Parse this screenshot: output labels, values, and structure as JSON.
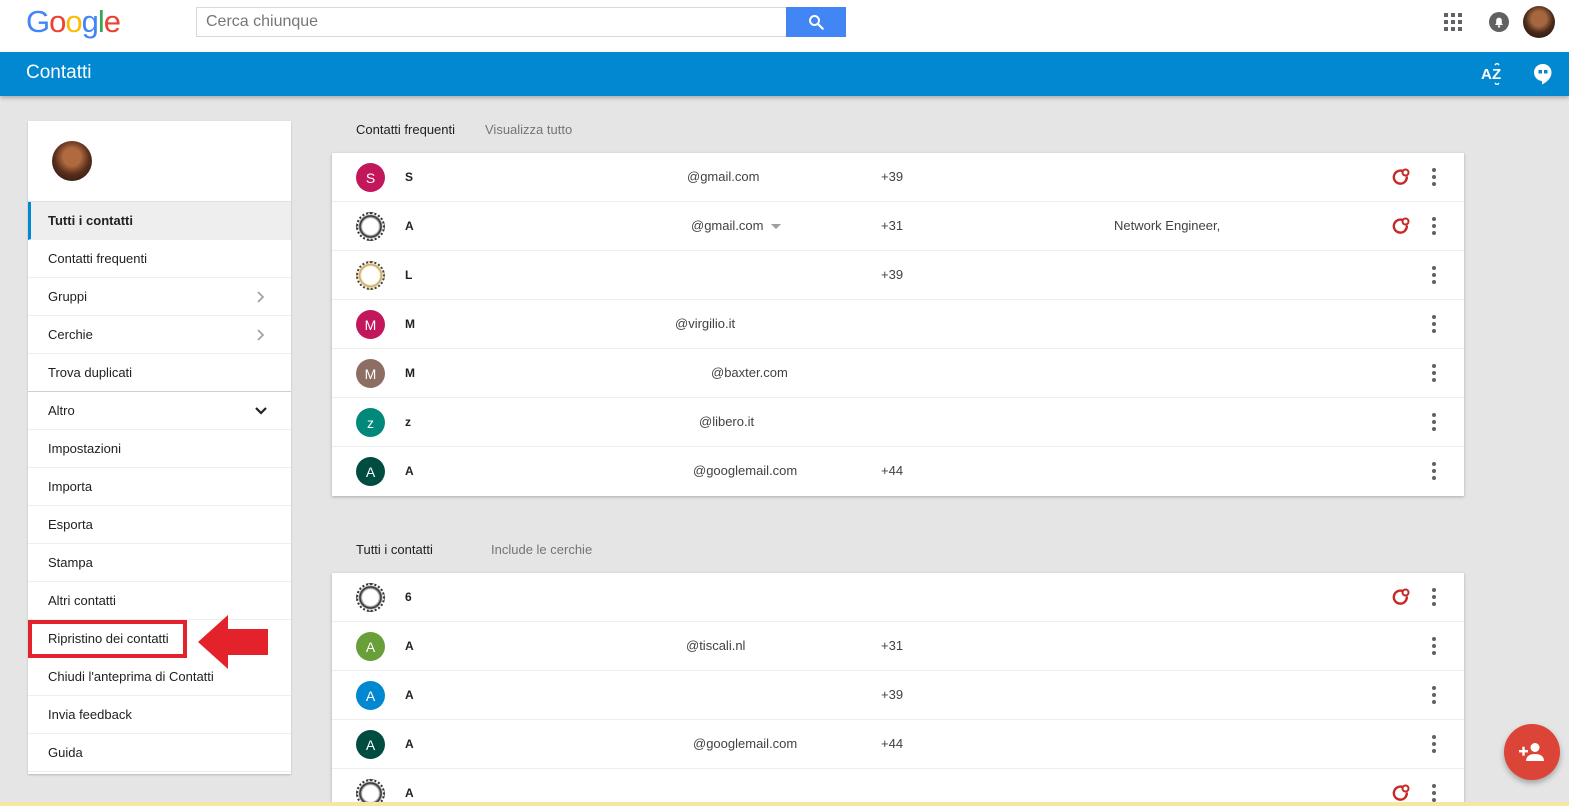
{
  "header": {
    "logo_letters": [
      {
        "ch": "G",
        "color": "#4285f4"
      },
      {
        "ch": "o",
        "color": "#ea4335"
      },
      {
        "ch": "o",
        "color": "#fbbc05"
      },
      {
        "ch": "g",
        "color": "#4285f4"
      },
      {
        "ch": "l",
        "color": "#34a853"
      },
      {
        "ch": "e",
        "color": "#ea4335"
      }
    ],
    "search_placeholder": "Cerca chiunque",
    "icons": [
      "search-icon",
      "apps-icon",
      "bell-icon",
      "avatar"
    ]
  },
  "appbar": {
    "title": "Contatti",
    "sort_label": "AZ",
    "accent": "#0288d1"
  },
  "sidebar": {
    "items": [
      {
        "label": "Tutti i contatti",
        "active": true
      },
      {
        "label": "Contatti frequenti"
      },
      {
        "label": "Gruppi",
        "chevron": "right"
      },
      {
        "label": "Cerchie",
        "chevron": "right"
      },
      {
        "label": "Trova duplicati"
      },
      {
        "label": "Altro",
        "chevron": "down"
      },
      {
        "label": "Impostazioni"
      },
      {
        "label": "Importa"
      },
      {
        "label": "Esporta"
      },
      {
        "label": "Stampa"
      },
      {
        "label": "Altri contatti"
      },
      {
        "label": "Ripristino dei contatti",
        "highlight": true
      },
      {
        "label": "Chiudi l'anteprima di Contatti"
      },
      {
        "label": "Invia feedback"
      },
      {
        "label": "Guida"
      }
    ]
  },
  "frequent": {
    "title": "Contatti frequenti",
    "link": "Visualizza tutto",
    "rows": [
      {
        "initial": "S",
        "avatar_color": "#c2185b",
        "name": "S",
        "email": "@gmail.com",
        "phone": "+39",
        "job": "",
        "circle": true
      },
      {
        "initial": "",
        "avatar_style": "photo",
        "name": "A",
        "email": "@gmail.com",
        "email_dropdown": true,
        "phone": "+31",
        "job": "Network Engineer,",
        "circle": true
      },
      {
        "initial": "",
        "avatar_style": "photo2",
        "name": "L",
        "email": "",
        "phone": "+39",
        "job": "",
        "circle": false
      },
      {
        "initial": "M",
        "avatar_color": "#c2185b",
        "name": "M",
        "email": "@virgilio.it",
        "phone": "",
        "job": "",
        "circle": false
      },
      {
        "initial": "M",
        "avatar_color": "#8d6e63",
        "name": "M",
        "email": "@baxter.com",
        "phone": "",
        "job": "",
        "circle": false
      },
      {
        "initial": "z",
        "avatar_color": "#00897b",
        "name": "z",
        "email": "@libero.it",
        "phone": "",
        "job": "",
        "circle": false
      },
      {
        "initial": "A",
        "avatar_color": "#004d40",
        "name": "A",
        "email": "@googlemail.com",
        "phone": "+44",
        "job": "",
        "circle": false
      }
    ]
  },
  "all": {
    "title": "Tutti i contatti",
    "note": "Include le cerchie",
    "rows": [
      {
        "initial": "",
        "avatar_style": "photo",
        "name": "6",
        "email": "",
        "phone": "",
        "job": "",
        "circle": true
      },
      {
        "initial": "A",
        "avatar_color": "#689f38",
        "name": "A",
        "email": "@tiscali.nl",
        "phone": "+31",
        "job": "",
        "circle": false
      },
      {
        "initial": "A",
        "avatar_color": "#0288d1",
        "name": "A",
        "email": "",
        "phone": "+39",
        "job": "",
        "circle": false
      },
      {
        "initial": "A",
        "avatar_color": "#004d40",
        "name": "A",
        "email": "@googlemail.com",
        "phone": "+44",
        "job": "",
        "circle": false
      },
      {
        "initial": "",
        "avatar_style": "photo",
        "name": "A",
        "email": "",
        "phone": "",
        "job": "",
        "circle": true
      }
    ]
  },
  "fab_icon": "add-person-icon"
}
